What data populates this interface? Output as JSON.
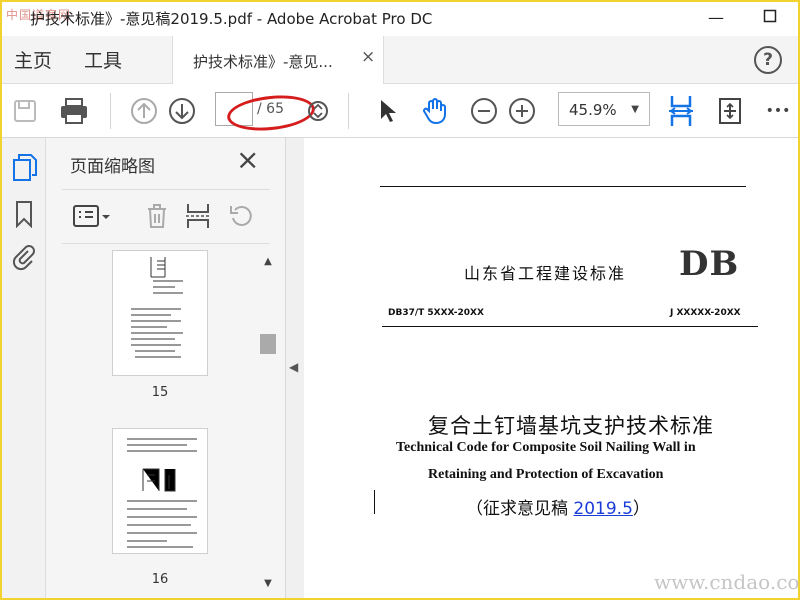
{
  "window": {
    "title": "护技术标准》-意见稿2019.5.pdf - Adobe Acrobat Pro DC",
    "logo_text": "中国道客网",
    "minimize": "—",
    "close": "×"
  },
  "nav": {
    "home": "主页",
    "tools": "工具",
    "tab_label": "护技术标准》-意见...",
    "tab_close": "×",
    "help": "?"
  },
  "toolbar": {
    "page_current": "",
    "page_total": "/ 65",
    "zoom": "45.9%",
    "more": "•••"
  },
  "panel": {
    "title": "页面缩略图",
    "close": "×",
    "thumbnails": [
      {
        "page": "15"
      },
      {
        "page": "16"
      }
    ]
  },
  "document": {
    "cn_standard": "山东省工程建设标准",
    "db_mark": "DB",
    "code_left": "DB37/T 5XXX-20XX",
    "code_right": "J XXXXX-20XX",
    "title_cn": "复合土钉墙基坑支护技术标准",
    "title_en_1": "Technical Code for Composite Soil Nailing Wall in",
    "title_en_2": "Retaining and Protection of Excavation",
    "subtitle_prefix": "（征求意见稿 ",
    "subtitle_link": "2019.5",
    "subtitle_suffix": "）"
  },
  "watermark": "www.cndao.com",
  "colors": {
    "accent": "#1473e6",
    "frame": "#f2d230",
    "annotation": "#d51d1d"
  }
}
